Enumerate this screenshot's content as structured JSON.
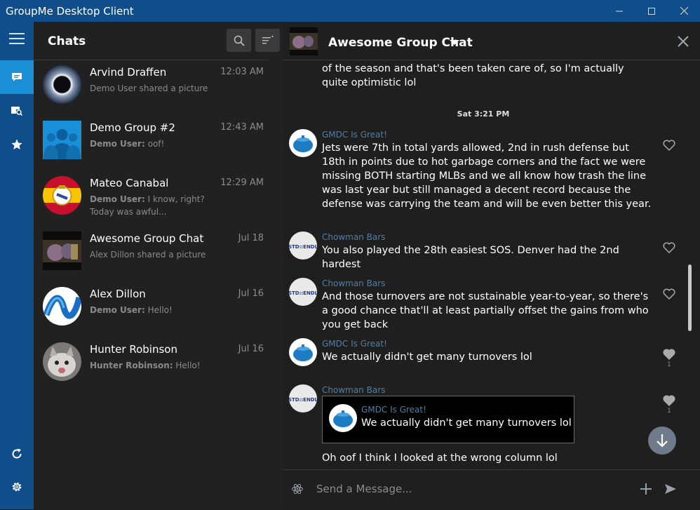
{
  "window": {
    "title": "GroupMe Desktop Client",
    "controls": [
      "minimize",
      "maximize",
      "close"
    ]
  },
  "rail": {
    "items": [
      "menu-icon",
      "chats-icon",
      "search-chat-icon",
      "star-icon",
      "refresh-icon",
      "settings-icon"
    ]
  },
  "chats": {
    "title": "Chats",
    "items": [
      {
        "name": "Arvind Draffen",
        "time": "12:03 AM",
        "preview": "Demo User shared a picture",
        "sender": ""
      },
      {
        "name": "Demo Group #2",
        "time": "12:43 AM",
        "sender": "Demo User:",
        "preview": " oof!"
      },
      {
        "name": "Mateo Canabal",
        "time": "12:29 AM",
        "sender": "Demo User:",
        "preview": " I know, right? Today was awful..."
      },
      {
        "name": "Awesome Group Chat",
        "time": "Jul 18",
        "preview": "Alex Dillon shared a picture",
        "sender": ""
      },
      {
        "name": "Alex Dillon",
        "time": "Jul 16",
        "sender": "Demo User:",
        "preview": " Hello!"
      },
      {
        "name": "Hunter Robinson",
        "time": "Jul 16",
        "sender": "Hunter Robinson:",
        "preview": " Hello!"
      }
    ]
  },
  "conversation": {
    "name": "Awesome Group Chat",
    "top_text": "of the season and that's been taken care of, so I'm actually quite optimistic lol",
    "day_separator": "Sat 3:21 PM",
    "messages": [
      {
        "sender": "GMDC Is Great!",
        "text": "Jets were 7th in total yards allowed, 2nd in rush defense but 18th in points due to hot garbage corners and the fact we were missing BOTH starting MLBs and we all know how trash the line was last year but still managed a decent record because the defense was carrying the team and will be even better this year.",
        "likes": ""
      },
      {
        "sender": "Chowman Bars",
        "text": "You also played the 28th easiest SOS. Denver had the 2nd hardest",
        "likes": ""
      },
      {
        "sender": "Chowman Bars",
        "text": "And those turnovers are not sustainable year-to-year, so there's a good chance that'll at least partially offset the gains from who you get back",
        "likes": ""
      },
      {
        "sender": "GMDC Is Great!",
        "text": "We actually didn't get many turnovers lol",
        "likes": "1"
      },
      {
        "sender": "Chowman Bars",
        "quote_sender": "GMDC Is Great!",
        "quote_text": "We actually didn't get many turnovers lol",
        "text": "",
        "likes": "1"
      }
    ],
    "last_text": "Oh oof I think I looked at the wrong column lol",
    "composer_placeholder": "Send a Message...",
    "std_label": "STD::ENDL"
  },
  "colors": {
    "titlebar": "#0f4e8a",
    "rail_active": "#1b8fd6",
    "sender": "#4f7fa8"
  }
}
